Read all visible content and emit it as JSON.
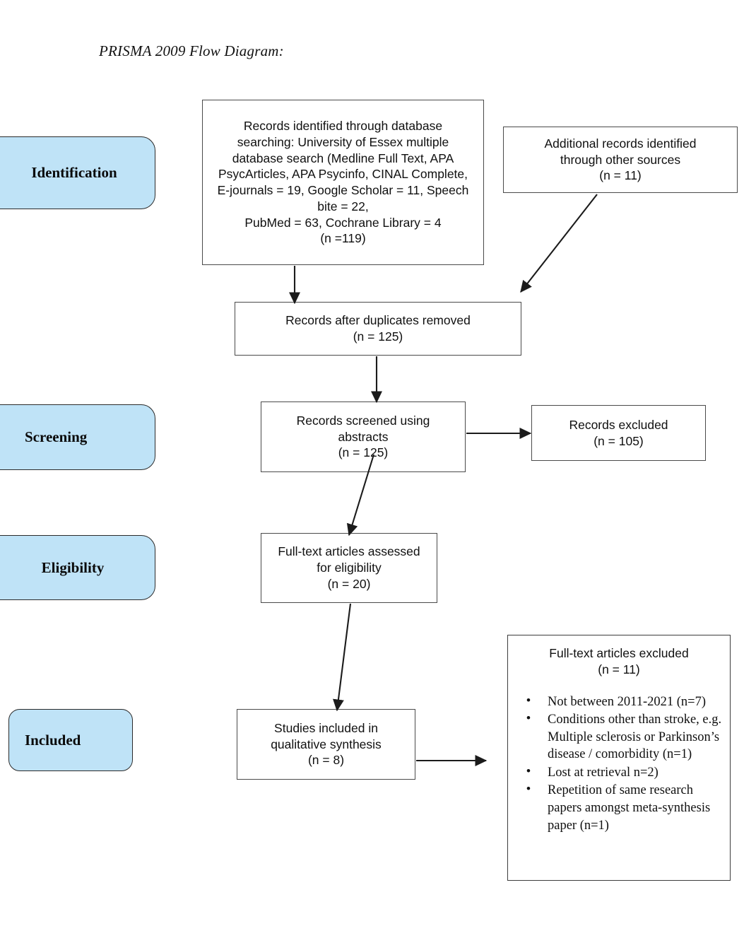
{
  "page": {
    "title": "PRISMA 2009 Flow Diagram:",
    "accent_blue": "#bfe3f7",
    "box_border": "#4a4a4a",
    "text_color": "#101010"
  },
  "stages": [
    {
      "id": "identification",
      "label": "Identification"
    },
    {
      "id": "screening",
      "label": "Screening"
    },
    {
      "id": "eligibility",
      "label": "Eligibility"
    },
    {
      "id": "included",
      "label": "Included"
    }
  ],
  "boxes": {
    "records_identified": {
      "text": "Records identified through database\nsearching: University of Essex multiple\ndatabase search (Medline Full Text, APA\nPsycArticles, APA Psycinfo, CINAL Complete,\nE-journals = 19, Google Scholar = 11, Speech\nbite = 22,\nPubMed = 63, Cochrane Library = 4\n(n =119)",
      "n": "119"
    },
    "additional_records": {
      "text": "Additional records identified\nthrough other sources\n(n = 11)",
      "n": "11"
    },
    "after_duplicates": {
      "text": "Records after duplicates removed\n(n = 125)",
      "n": "125"
    },
    "screened": {
      "text": "Records screened using\nabstracts\n(n = 125)",
      "n": "125"
    },
    "records_excluded": {
      "text": "Records excluded\n(n = 105)",
      "n": "105"
    },
    "fulltext_assessed": {
      "text": "Full-text articles assessed\nfor eligibility\n(n = 20)",
      "n": "20"
    },
    "studies_included": {
      "text": "Studies included in\nqualitative synthesis\n(n = 8)",
      "n": "8"
    },
    "fulltext_excluded": {
      "heading": "Full-text articles excluded\n(n = 11)",
      "n": "11",
      "reasons": [
        "Not between 2011-2021 (n=7)",
        "Conditions other than stroke, e.g. Multiple sclerosis or Parkinson’s disease / comorbidity (n=1)",
        "Lost at retrieval n=2)",
        "Repetition of same research papers amongst meta-synthesis paper (n=1)"
      ]
    }
  }
}
